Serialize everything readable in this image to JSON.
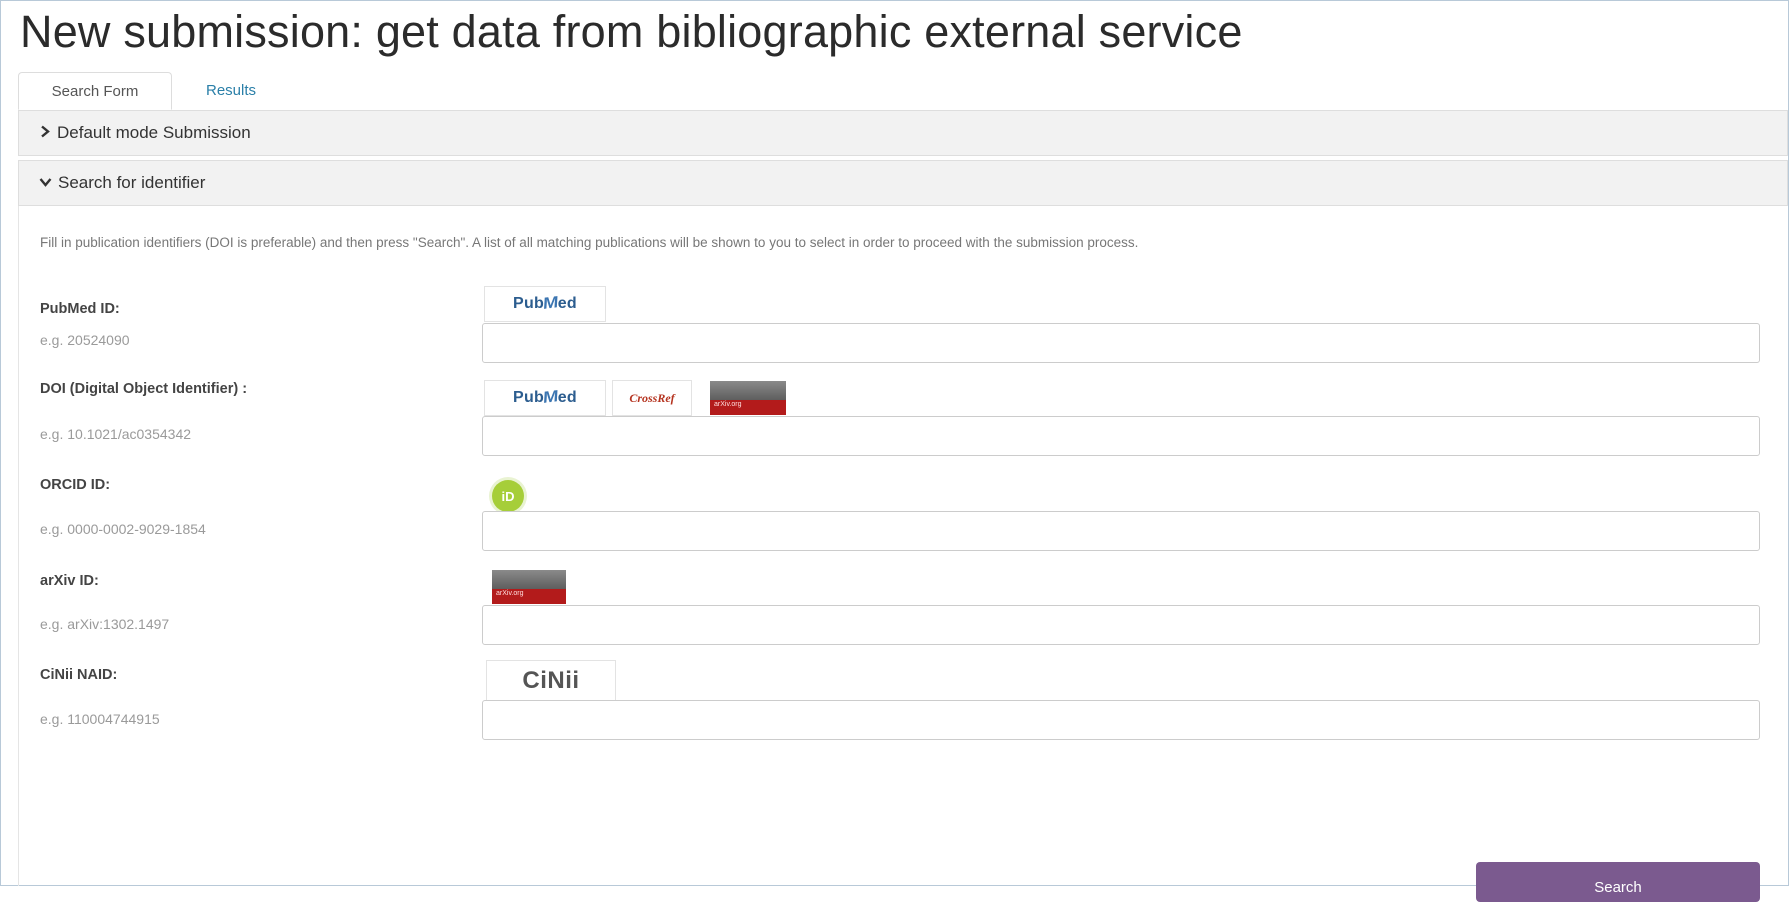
{
  "page": {
    "title": "New submission: get data from bibliographic external service"
  },
  "tabs": [
    {
      "label": "Search Form",
      "active": true
    },
    {
      "label": "Results",
      "active": false
    }
  ],
  "panels": {
    "default_mode": {
      "label": "Default mode Submission",
      "expanded": false
    },
    "search_identifier": {
      "label": "Search for identifier",
      "expanded": true
    }
  },
  "instructions": "Fill in publication identifiers (DOI is preferable) and then press \"Search\". A list of all matching publications will be shown to you to select in order to proceed with the submission process.",
  "fields": {
    "pubmed": {
      "label": "PubMed ID:",
      "hint": "e.g. 20524090",
      "value": ""
    },
    "doi": {
      "label": "DOI (Digital Object Identifier) :",
      "hint": "e.g. 10.1021/ac0354342",
      "value": ""
    },
    "orcid": {
      "label": "ORCID ID:",
      "hint": "e.g. 0000-0002-9029-1854",
      "value": ""
    },
    "arxiv": {
      "label": "arXiv ID:",
      "hint": "e.g. arXiv:1302.1497",
      "value": ""
    },
    "cinii": {
      "label": "CiNii NAID:",
      "hint": "e.g. 110004744915",
      "value": ""
    }
  },
  "logos": {
    "pubmed_text_a": "Pub",
    "pubmed_text_m": "M",
    "pubmed_text_b": "ed",
    "crossref_text": "CrossRef",
    "arxiv_text": "arXiv.org",
    "orcid_text": "iD",
    "cinii_text": "CiNii"
  },
  "search_button": {
    "label": "Search"
  },
  "colors": {
    "button": "#7b5a8f",
    "tab_link": "#2a7fa8",
    "panel_heading_bg": "#f2f2f2",
    "orcid_green": "#a6ce39",
    "arxiv_red": "#b31b1b"
  },
  "icons": {
    "collapsed": "chevron-right-icon",
    "expanded": "chevron-down-icon"
  }
}
